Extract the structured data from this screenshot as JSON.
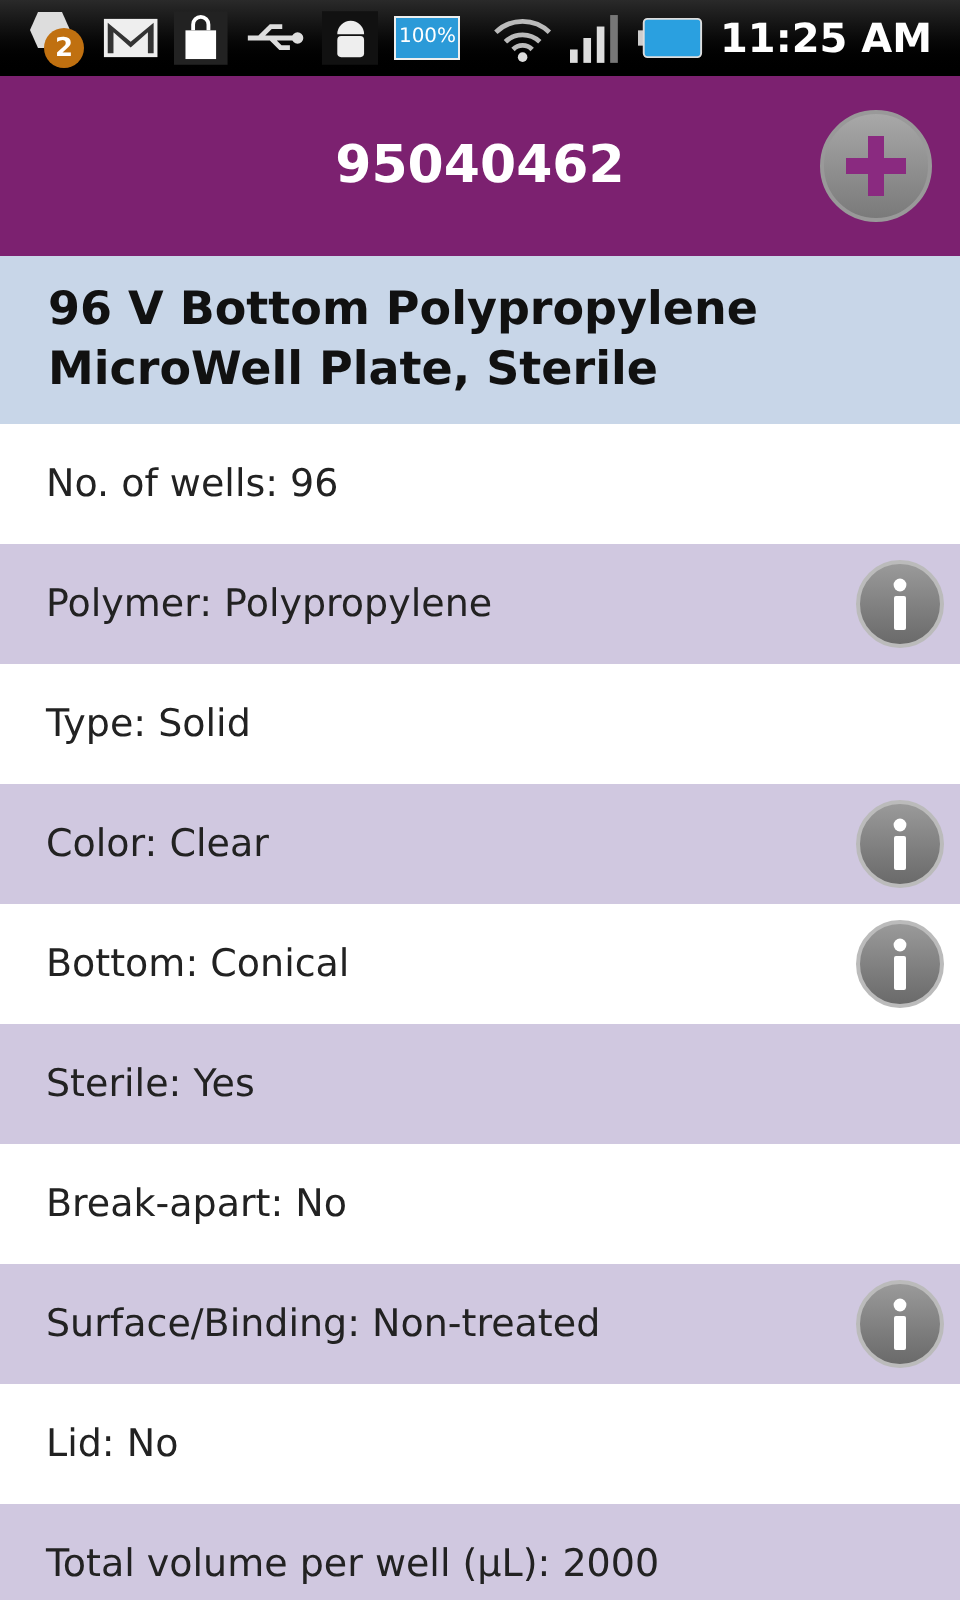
{
  "status_bar": {
    "badge": "2",
    "battery_icon_text": "100%",
    "time": "11:25 AM"
  },
  "header": {
    "title": "95040462"
  },
  "product": {
    "name": "96 V Bottom Polypropylene MicroWell Plate, Sterile"
  },
  "rows": [
    {
      "label": "No. of wells: 96",
      "info": false
    },
    {
      "label": "Polymer: Polypropylene",
      "info": true
    },
    {
      "label": "Type: Solid",
      "info": false
    },
    {
      "label": "Color: Clear",
      "info": true
    },
    {
      "label": "Bottom: Conical",
      "info": true
    },
    {
      "label": "Sterile: Yes",
      "info": false
    },
    {
      "label": "Break-apart: No",
      "info": false
    },
    {
      "label": "Surface/Binding: Non-treated",
      "info": true
    },
    {
      "label": "Lid: No",
      "info": false
    },
    {
      "label": "Total volume per well (µL): 2000",
      "info": false
    }
  ]
}
